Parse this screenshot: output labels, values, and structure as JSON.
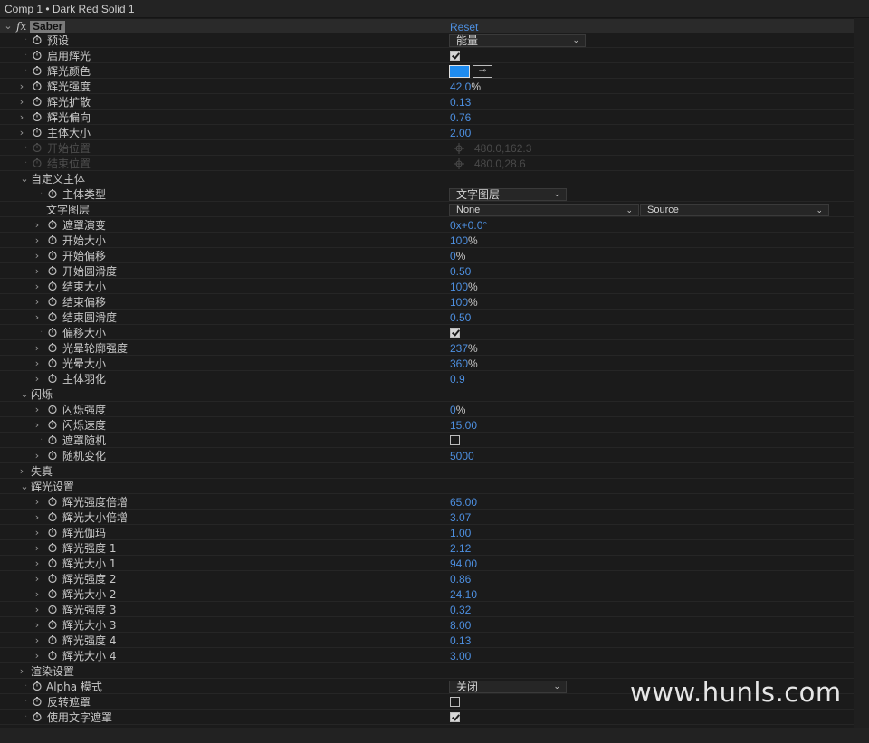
{
  "window": {
    "title": "Comp 1 • Dark Red Solid 1"
  },
  "effect": {
    "fx_symbol": "fx",
    "name": "Saber",
    "reset_label": "Reset"
  },
  "rows": {
    "preset": {
      "label": "预设",
      "value": "能量"
    },
    "enable_glow": {
      "label": "启用辉光",
      "checked": true
    },
    "glow_color": {
      "label": "辉光颜色",
      "color": "#1f8cf0"
    },
    "glow_intensity": {
      "label": "辉光强度",
      "value": "42.0",
      "unit": "%"
    },
    "glow_spread": {
      "label": "辉光扩散",
      "value": "0.13"
    },
    "glow_bias": {
      "label": "辉光偏向",
      "value": "0.76"
    },
    "core_size": {
      "label": "主体大小",
      "value": "2.00"
    },
    "start_pos": {
      "label": "开始位置",
      "value": "480.0,162.3"
    },
    "end_pos": {
      "label": "结束位置",
      "value": "480.0,28.6"
    },
    "custom_core": {
      "label": "自定义主体"
    },
    "core_type": {
      "label": "主体类型",
      "value": "文字图层"
    },
    "text_layer": {
      "label": "文字图层",
      "value": "None",
      "source": "Source"
    },
    "mask_evolution": {
      "label": "遮罩演变",
      "value": "0x+0.0°"
    },
    "start_size": {
      "label": "开始大小",
      "value": "100",
      "unit": "%"
    },
    "start_offset": {
      "label": "开始偏移",
      "value": "0",
      "unit": "%"
    },
    "start_roundness": {
      "label": "开始圆滑度",
      "value": "0.50"
    },
    "end_size": {
      "label": "结束大小",
      "value": "100",
      "unit": "%"
    },
    "end_offset": {
      "label": "结束偏移",
      "value": "100",
      "unit": "%"
    },
    "end_roundness": {
      "label": "结束圆滑度",
      "value": "0.50"
    },
    "offset_size": {
      "label": "偏移大小",
      "checked": true
    },
    "halo_outline": {
      "label": "光晕轮廓强度",
      "value": "237",
      "unit": "%"
    },
    "halo_size": {
      "label": "光晕大小",
      "value": "360",
      "unit": "%"
    },
    "core_feather": {
      "label": "主体羽化",
      "value": "0.9"
    },
    "flicker": {
      "label": "闪烁"
    },
    "flicker_intensity": {
      "label": "闪烁强度",
      "value": "0",
      "unit": "%"
    },
    "flicker_speed": {
      "label": "闪烁速度",
      "value": "15.00"
    },
    "mask_random": {
      "label": "遮罩随机",
      "checked": false
    },
    "random_seed": {
      "label": "随机变化",
      "value": "5000"
    },
    "distortion": {
      "label": "失真"
    },
    "glow_settings": {
      "label": "辉光设置"
    },
    "gs_intensity_mult": {
      "label": "辉光强度倍增",
      "value": "65.00"
    },
    "gs_size_mult": {
      "label": "辉光大小倍增",
      "value": "3.07"
    },
    "gs_gamma": {
      "label": "辉光伽玛",
      "value": "1.00"
    },
    "gs_int1": {
      "label": "辉光强度 1",
      "value": "2.12"
    },
    "gs_size1": {
      "label": "辉光大小 1",
      "value": "94.00"
    },
    "gs_int2": {
      "label": "辉光强度 2",
      "value": "0.86"
    },
    "gs_size2": {
      "label": "辉光大小 2",
      "value": "24.10"
    },
    "gs_int3": {
      "label": "辉光强度 3",
      "value": "0.32"
    },
    "gs_size3": {
      "label": "辉光大小 3",
      "value": "8.00"
    },
    "gs_int4": {
      "label": "辉光强度 4",
      "value": "0.13"
    },
    "gs_size4": {
      "label": "辉光大小 4",
      "value": "3.00"
    },
    "render_settings": {
      "label": "渲染设置"
    },
    "alpha_mode": {
      "label": "Alpha 模式",
      "value": "关闭"
    },
    "invert_mask": {
      "label": "反转遮罩",
      "checked": false
    },
    "use_text_mask": {
      "label": "使用文字遮罩",
      "checked": true
    }
  },
  "watermark": "www.hunls.com",
  "colors": {
    "value_blue": "#4d8fe0",
    "panel_bg": "#1b1b1b",
    "accent_swatch": "#1f8cf0"
  }
}
